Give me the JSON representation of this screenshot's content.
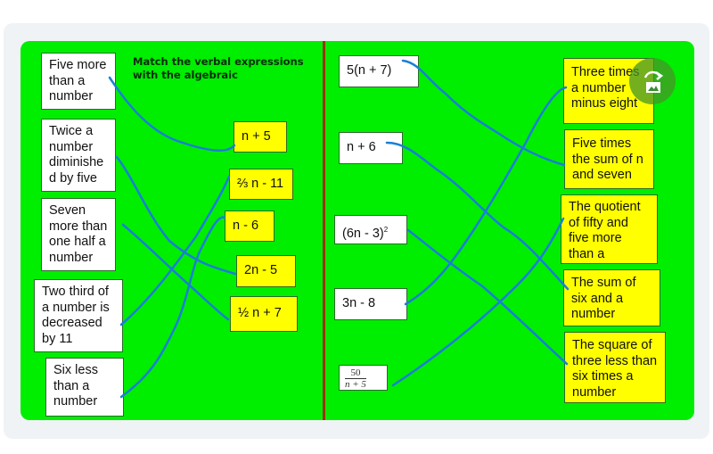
{
  "title": "Match the verbal expressions\nwith the algebraic",
  "colors": {
    "board": "#00ee00",
    "divider": "#a0300a",
    "line": "#1a7fd6",
    "yellow_box": "#ffff00",
    "white_box": "#ffffff"
  },
  "left_panel": {
    "verbal": [
      {
        "text": "Five more than a number"
      },
      {
        "text": "Twice a number diminishe d by five"
      },
      {
        "text": "Seven more than one half a number"
      },
      {
        "text": "Two third of a number is decreased by 11"
      },
      {
        "text": "Six less than a number"
      }
    ],
    "algebraic": [
      {
        "text": "n + 5"
      },
      {
        "text": "⅔ n - 11"
      },
      {
        "text": "n - 6"
      },
      {
        "text": "2n - 5"
      },
      {
        "text": "½ n + 7"
      }
    ]
  },
  "right_panel": {
    "algebraic": [
      {
        "text": "5(n + 7)"
      },
      {
        "text": "n + 6"
      },
      {
        "text": "(6n - 3)",
        "sup": "2"
      },
      {
        "text": "3n - 8"
      },
      {
        "numerator": "50",
        "denominator": "n + 5"
      }
    ],
    "verbal": [
      {
        "text": "Three times a number minus eight"
      },
      {
        "text": "Five times the sum of n and seven"
      },
      {
        "text": "The quotient of fifty and five more than a number"
      },
      {
        "text": "The sum of six and a number"
      },
      {
        "text": "The square of three less than six times a number"
      }
    ]
  },
  "matches": {
    "left": [
      [
        "Five more than a number",
        "n + 5"
      ],
      [
        "Twice a number diminishe d by five",
        "2n - 5"
      ],
      [
        "Seven more than one half a number",
        "½ n + 7"
      ],
      [
        "Two third of a number is decreased by 11",
        "⅔ n - 11"
      ],
      [
        "Six less than a number",
        "n - 6"
      ]
    ],
    "right": [
      [
        "5(n + 7)",
        "Five times the sum of n and seven"
      ],
      [
        "n + 6",
        "The sum of six and a number"
      ],
      [
        "(6n - 3)2",
        "The square of three less than six times a number"
      ],
      [
        "3n - 8",
        "Three times a number minus eight"
      ],
      [
        "50/(n + 5)",
        "The quotient of fifty and five more than a number"
      ]
    ]
  },
  "controls": {
    "rotate_icon": "rotate-image-icon"
  }
}
